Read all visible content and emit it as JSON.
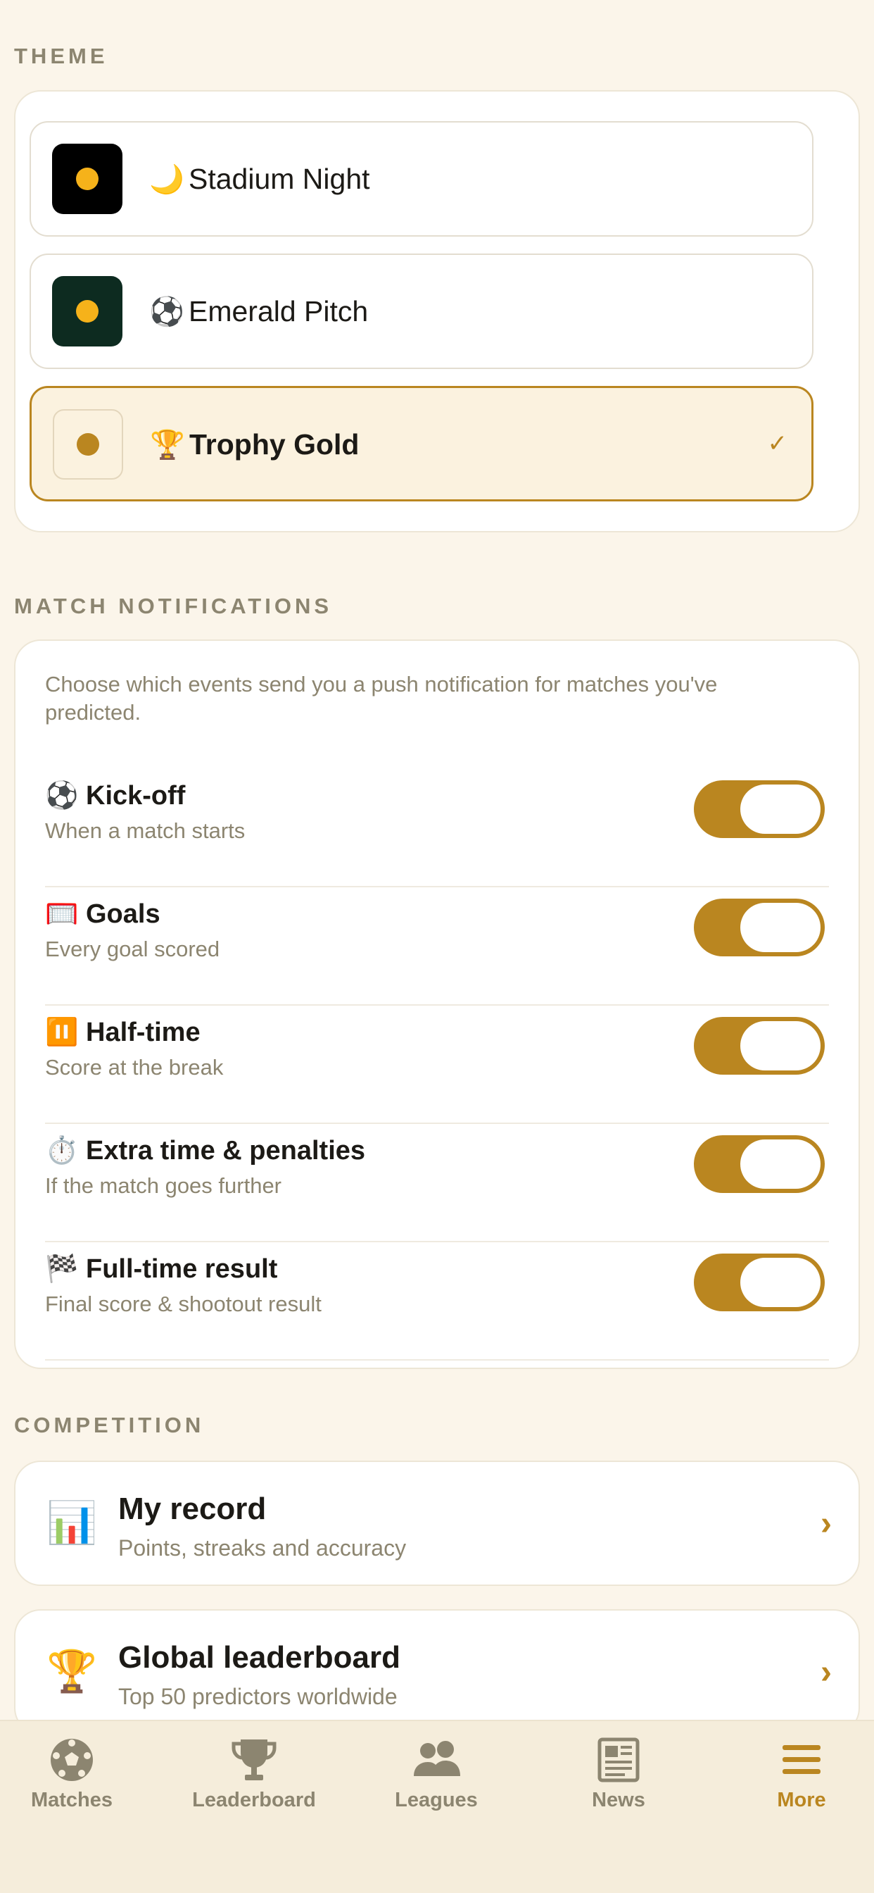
{
  "theme_section": {
    "title": "THEME",
    "options": [
      {
        "emoji": "🌙",
        "label": "Stadium Night",
        "swatch_bg": "#000000",
        "dot_color": "#F6B21A",
        "selected": false
      },
      {
        "emoji": "⚽",
        "label": "Emerald Pitch",
        "swatch_bg": "#0D2B20",
        "dot_color": "#F6B21A",
        "selected": false
      },
      {
        "emoji": "🏆",
        "label": "Trophy Gold",
        "swatch_bg": "#FBF2DF",
        "dot_color": "#BA8620",
        "selected": true,
        "check": "✓"
      }
    ]
  },
  "notifications": {
    "title": "MATCH NOTIFICATIONS",
    "description": "Choose which events send you a push notification for matches you've predicted.",
    "items": [
      {
        "emoji": "⚽",
        "title": "Kick-off",
        "subtitle": "When a match starts",
        "enabled": true
      },
      {
        "emoji": "🥅",
        "title": "Goals",
        "subtitle": "Every goal scored",
        "enabled": true
      },
      {
        "emoji": "⏸️",
        "title": "Half-time",
        "subtitle": "Score at the break",
        "enabled": true
      },
      {
        "emoji": "⏱️",
        "title": "Extra time & penalties",
        "subtitle": "If the match goes further",
        "enabled": true
      },
      {
        "emoji": "🏁",
        "title": "Full-time result",
        "subtitle": "Final score & shootout result",
        "enabled": true
      }
    ]
  },
  "competition": {
    "title": "COMPETITION",
    "items": [
      {
        "icon": "📊",
        "title": "My record",
        "subtitle": "Points, streaks and accuracy",
        "chevron": "›"
      },
      {
        "icon": "🏆",
        "title": "Global leaderboard",
        "subtitle": "Top 50 predictors worldwide",
        "chevron": "›"
      }
    ]
  },
  "bottom_nav": {
    "items": [
      {
        "label": "Matches",
        "icon": "soccer-ball-icon",
        "active": false
      },
      {
        "label": "Leaderboard",
        "icon": "trophy-icon",
        "active": false
      },
      {
        "label": "Leagues",
        "icon": "people-icon",
        "active": false
      },
      {
        "label": "News",
        "icon": "newspaper-icon",
        "active": false
      },
      {
        "label": "More",
        "icon": "menu-icon",
        "active": true
      }
    ]
  },
  "colors": {
    "accent": "#BA8620",
    "background": "#FBF5EA",
    "muted_text": "#8C8570",
    "nav_inactive": "#8C8570"
  }
}
